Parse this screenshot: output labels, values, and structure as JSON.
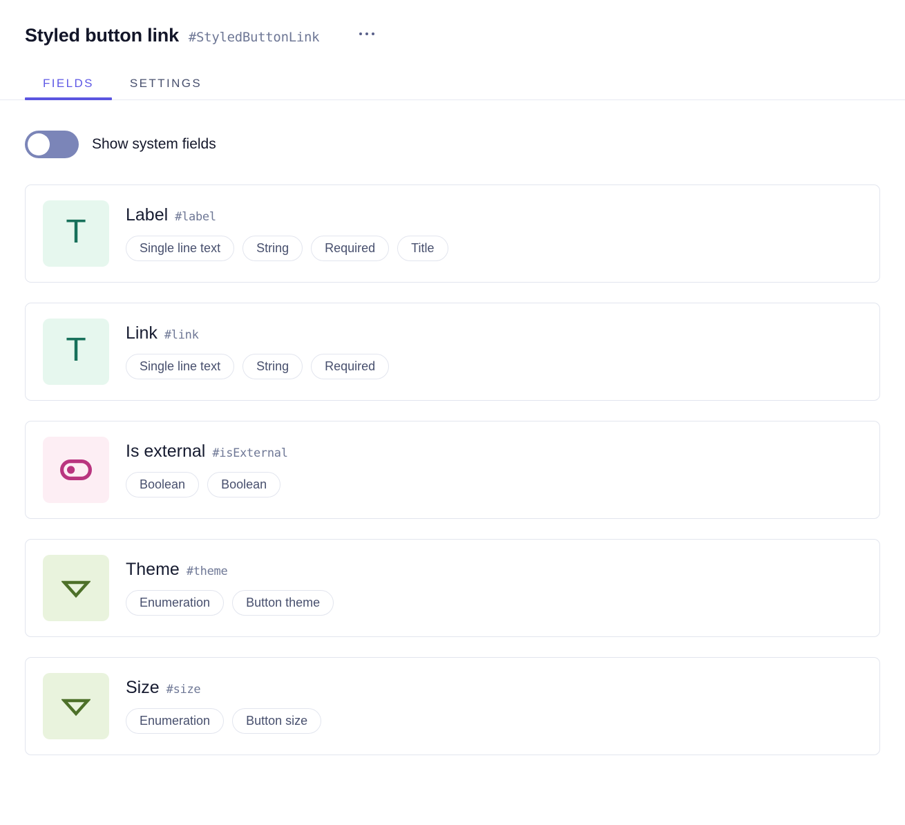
{
  "header": {
    "title": "Styled button link",
    "handle": "#StyledButtonLink",
    "overflow_menu_name": "more-options"
  },
  "tabs": [
    {
      "label": "FIELDS",
      "active": true
    },
    {
      "label": "SETTINGS",
      "active": false
    }
  ],
  "system_fields_toggle": {
    "label": "Show system fields",
    "on": false
  },
  "colors": {
    "accent": "#5b55e0",
    "tab_inactive": "#474f6d",
    "title": "#131629",
    "handle": "#6e7795",
    "card_border": "#e2e5ee",
    "toggle_track": "#7b85b8",
    "icon_text_bg": "#e6f7ee",
    "icon_text_fg": "#17705a",
    "icon_bool_bg": "#fdeef4",
    "icon_bool_fg": "#b9357f",
    "icon_enum_bg": "#e9f3dd",
    "icon_enum_fg": "#4d7029"
  },
  "fields": [
    {
      "name": "Label",
      "handle": "#label",
      "icon": "single-line-text-icon",
      "icon_kind": "text",
      "tags": [
        "Single line text",
        "String",
        "Required",
        "Title"
      ]
    },
    {
      "name": "Link",
      "handle": "#link",
      "icon": "single-line-text-icon",
      "icon_kind": "text",
      "tags": [
        "Single line text",
        "String",
        "Required"
      ]
    },
    {
      "name": "Is external",
      "handle": "#isExternal",
      "icon": "boolean-toggle-icon",
      "icon_kind": "bool",
      "tags": [
        "Boolean",
        "Boolean"
      ]
    },
    {
      "name": "Theme",
      "handle": "#theme",
      "icon": "enumeration-dropdown-icon",
      "icon_kind": "enum",
      "tags": [
        "Enumeration",
        "Button theme"
      ]
    },
    {
      "name": "Size",
      "handle": "#size",
      "icon": "enumeration-dropdown-icon",
      "icon_kind": "enum",
      "tags": [
        "Enumeration",
        "Button size"
      ]
    }
  ]
}
